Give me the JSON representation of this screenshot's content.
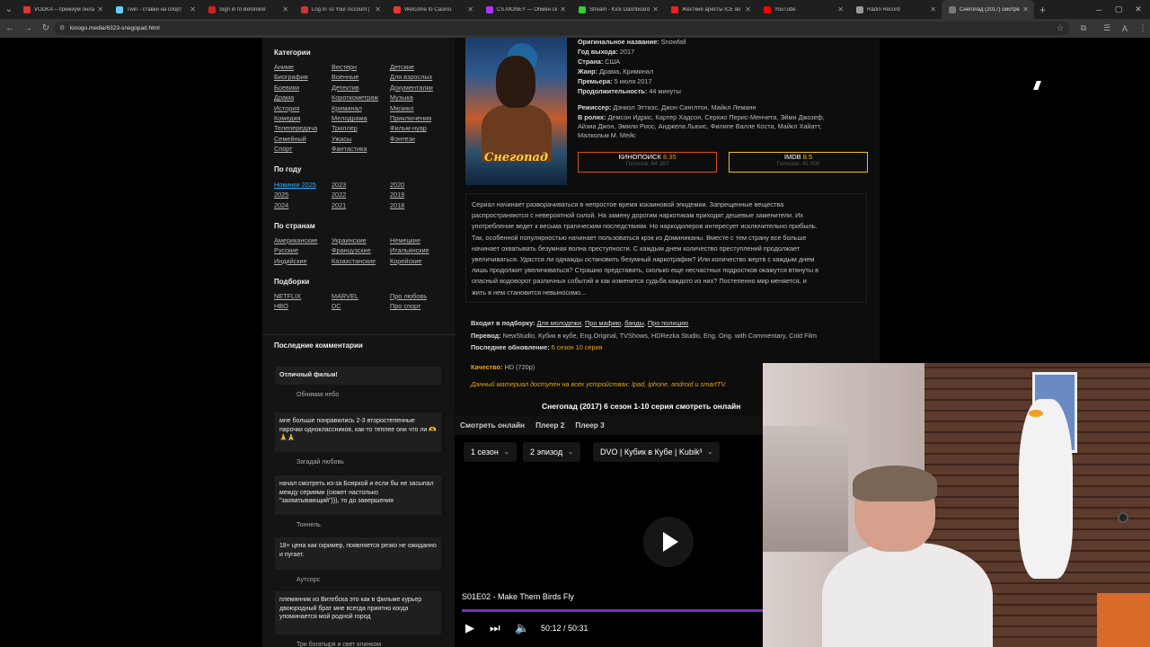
{
  "browser": {
    "tabs": [
      {
        "label": "VODKA – премиум онла",
        "color": "#d33"
      },
      {
        "label": "Twin - ставки на спорт",
        "color": "#6cf"
      },
      {
        "label": "Sign in to Betonline",
        "color": "#c22"
      },
      {
        "label": "Log In To Your Account |",
        "color": "#c33"
      },
      {
        "label": "Welcome to Casino.",
        "color": "#e33"
      },
      {
        "label": "CS.MONEY — Обмен ск",
        "color": "#a3f"
      },
      {
        "label": "Stream - Kick Dashboard",
        "color": "#3c3"
      },
      {
        "label": "Жесткие аресты ICE во",
        "color": "#e22"
      },
      {
        "label": "YouTube",
        "color": "#f00"
      },
      {
        "label": "Radio Record",
        "color": "#999"
      },
      {
        "label": "Снегопад (2017) смотре",
        "color": "#777"
      }
    ],
    "url": "kinogo.media/6323-snegopad.html"
  },
  "sidebar": {
    "categories_title": "Категории",
    "categories": [
      [
        "Аниме",
        "Биография",
        "Боевики",
        "Драма",
        "История",
        "Комедия",
        "Телепередача",
        "Семейный",
        "Спорт"
      ],
      [
        "Вестерн",
        "Военные",
        "Детектив",
        "Короткометраж",
        "Криминал",
        "Мелодрама",
        "Триллер",
        "Ужасы",
        "Фантастика"
      ],
      [
        "Детские",
        "Для взрослых",
        "Документалки",
        "Музыка",
        "Мюзикл",
        "Приключения",
        "Фильм-нуар",
        "Фэнтези"
      ]
    ],
    "by_year_title": "По году",
    "years": [
      [
        "Новинки 2025",
        "2025",
        "2024"
      ],
      [
        "2023",
        "2022",
        "2021"
      ],
      [
        "2020",
        "2019",
        "2018"
      ]
    ],
    "by_country_title": "По странам",
    "countries": [
      [
        "Американские",
        "Русские",
        "Индийские"
      ],
      [
        "Украинские",
        "Французские",
        "Казахстанские"
      ],
      [
        "Немецкие",
        "Итальянские",
        "Корейские"
      ]
    ],
    "collections_title": "Подборки",
    "collections": [
      [
        "NETFLIX",
        "HBO"
      ],
      [
        "MARVEL",
        "DC"
      ],
      [
        "Про любовь",
        "Про спорт"
      ]
    ],
    "comments_title": "Последние комментарии",
    "comments": [
      {
        "text": "Отличный фильм!",
        "author": "Обнимая небо"
      },
      {
        "text": "мне больше понравились 2-3 второстепенные парочки одноклассников, как-то теплее они что ли 🫶🙏🙏",
        "author": "Загадай любовь"
      },
      {
        "text": "начал смотреть из-за Бояркой и если бы не засыпал между сериями (сюжет настолько \"захватывающий\"))), то до завершения",
        "author": "Тоннель"
      },
      {
        "text": "18+ цена как скример, появляется резко не ожиданно и пугает.",
        "author": "Аутсорс"
      },
      {
        "text": "племянник из Витебска это как в фильме курьер двоюродный брат мне всегда приятно когда упоминается мой родной город",
        "author": "Три богатыря и свет клинком"
      }
    ]
  },
  "movie": {
    "poster_title": "Снегопад",
    "original_title_label": "Оригинальное название:",
    "original_title": "Snowfall",
    "year_label": "Год выхода:",
    "year": "2017",
    "country_label": "Страна:",
    "country": "США",
    "genre_label": "Жанр:",
    "genre": "Драма, Криминал",
    "premiere_label": "Премьера:",
    "premiere": "5 июля 2017",
    "duration_label": "Продолжительность:",
    "duration": "44 минуты",
    "director_label": "Режиссер:",
    "director": "Дэнизл Эттиэс, Джон Синглтон, Майкл Леманн",
    "cast_label": "В ролях:",
    "cast_line1": "Демсон Идрис, Картер Хадсон, Серхио Перис-Менчета, Эйми Джозеф,",
    "cast_line2": "Айзиа Джон, Эмили Риос, Анджела Льюис, Филипе Валле Коста, Майкл Хайатт,",
    "cast_line3": "Малкольм М. Мейс",
    "kinopoisk_name": "КИНОПОИСК",
    "kinopoisk_score": "8.35",
    "kinopoisk_votes": "Голосов: 64 387",
    "imdb_name": "IMDB",
    "imdb_score": "8.5",
    "imdb_votes": "Голосов: 45 000",
    "description_lines": [
      "Сериал начинает разворачиваться в непростое время кокаиновой эпидемии. Запрещенные вещества",
      "распространяются с невероятной силой. На замену дорогим наркотикам приходят дешевые заменители. Их",
      "употребление ведет к весьма трагическим последствиям. Но наркодилеров интересует исключительно прибыль.",
      "Так, особенной популярностью начинает пользоваться крэк из Доминиканы. Вместе с тем страну все больше",
      "начинает охватывать безумная волна преступности. С каждым днем количество преступлений продолжает",
      "увеличиваться. Удастся ли однажды остановить безумный наркотрафик? Или количество жертв с каждым днем",
      "лишь продолжит увеличиваться? Страшно представить, сколько еще несчастных подростков окажутся втянуты в",
      "опасный водоворот различных событий и как изменится судьба каждого из них? Постепенно мир меняется, и",
      "жить в нем становится невыносимо..."
    ],
    "collections_label": "Входит в подборку:",
    "collection_links": [
      "Для молодежи",
      "Про мафию",
      "банды",
      "Про полицию"
    ],
    "translation_label": "Перевод:",
    "translation": "NewStudio, Кубик в кубе, Eng.Original, TVShows, HDRezka Studio, Eng. Orig. with Commentary, Cold Film",
    "update_label": "Последнее обновление:",
    "update": "6 сезон 10 серия",
    "quality_label": "Качество:",
    "quality": "HD (720p)",
    "devices_note": "Данный материал доступен на всех устройствах: Ipad, iphone, android и smartTV.",
    "watch_title": "Снегопад (2017) 6 сезон 1-10 серия смотреть онлайн"
  },
  "player": {
    "tabs": [
      "Смотреть онлайн",
      "Плеер 2",
      "Плеер 3"
    ],
    "season": "1 сезон",
    "episode": "2 эпизод",
    "voice": "DVO | Кубик в Кубе | Kubik³",
    "episode_title": "S01E02 - Make Them Birds Fly",
    "time": "50:12 / 50:31",
    "progress": 0.994,
    "accent": "#7b2fbf"
  },
  "colors": {
    "kinopoisk_border": "#d2521e",
    "kinopoisk_score": "#f08b3a",
    "imdb_border": "#f0c020",
    "imdb_score": "#f5c518",
    "new_year_link": "#2fb0ff"
  }
}
